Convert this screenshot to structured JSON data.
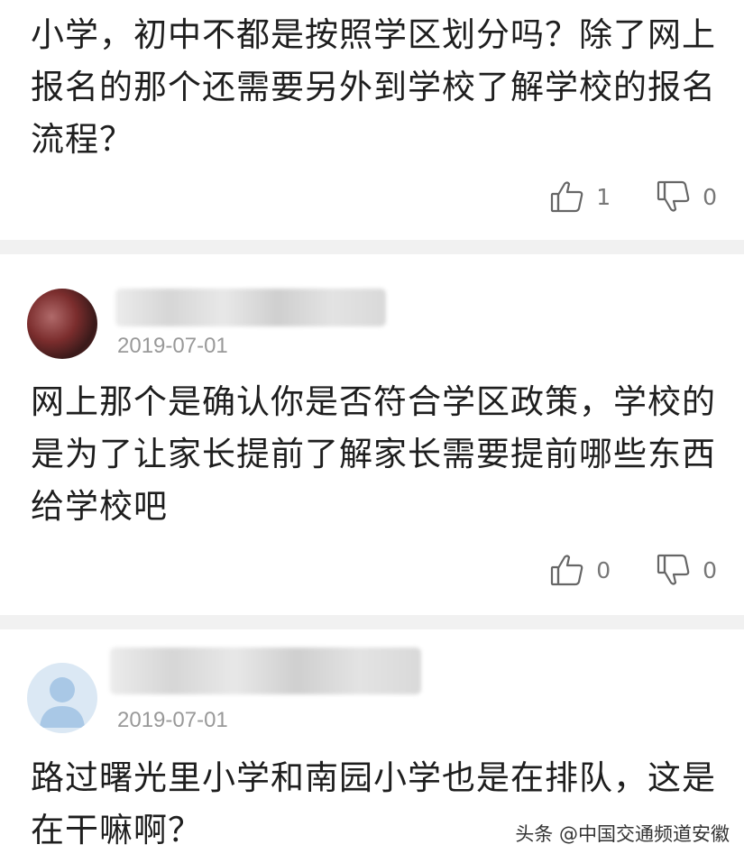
{
  "comments": [
    {
      "text": "小学，初中不都是按照学区划分吗？除了网上报名的那个还需要另外到学校了解学校的报名流程？",
      "likes": "1",
      "dislikes": "0"
    },
    {
      "date": "2019-07-01",
      "text": "网上那个是确认你是否符合学区政策，学校的是为了让家长提前了解家长需要提前哪些东西给学校吧",
      "likes": "0",
      "dislikes": "0"
    },
    {
      "date": "2019-07-01",
      "text": "路过曙光里小学和南园小学也是在排队，这是在干嘛啊？"
    }
  ],
  "watermark": "头条 @中国交通频道安徽",
  "icons": [
    "thumbs-up-icon",
    "thumbs-down-icon",
    "avatar-icon"
  ]
}
